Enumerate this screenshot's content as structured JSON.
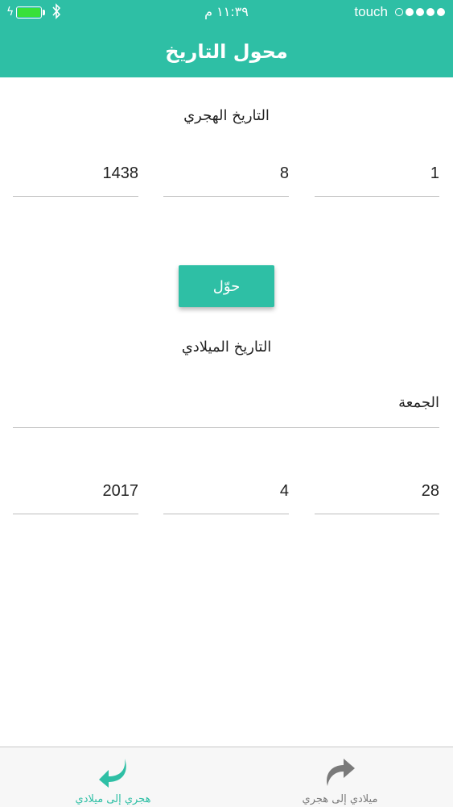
{
  "status_bar": {
    "time": "١١:٣٩ م",
    "carrier": "touch",
    "battery_icon": "battery-full-icon",
    "bluetooth_icon": "bluetooth-icon",
    "signal_icon": "signal-dots-icon",
    "signal_strength": "4/5"
  },
  "header": {
    "title": "محول التاريخ"
  },
  "hijri": {
    "title": "التاريخ الهجري",
    "day": "1",
    "month": "8",
    "year": "1438"
  },
  "convert_button": {
    "label": "حوّل"
  },
  "gregorian": {
    "title": "التاريخ الميلادي",
    "weekday": "الجمعة",
    "day": "28",
    "month": "4",
    "year": "2017"
  },
  "tabs": [
    {
      "label": "هجري إلى ميلادي",
      "icon": "return-arrow-icon",
      "active": true
    },
    {
      "label": "ميلادي إلى هجري",
      "icon": "forward-arrow-icon",
      "active": false
    }
  ],
  "colors": {
    "accent": "#2ebfa5",
    "battery": "#38e03a",
    "inactive": "#7a7a7a"
  }
}
